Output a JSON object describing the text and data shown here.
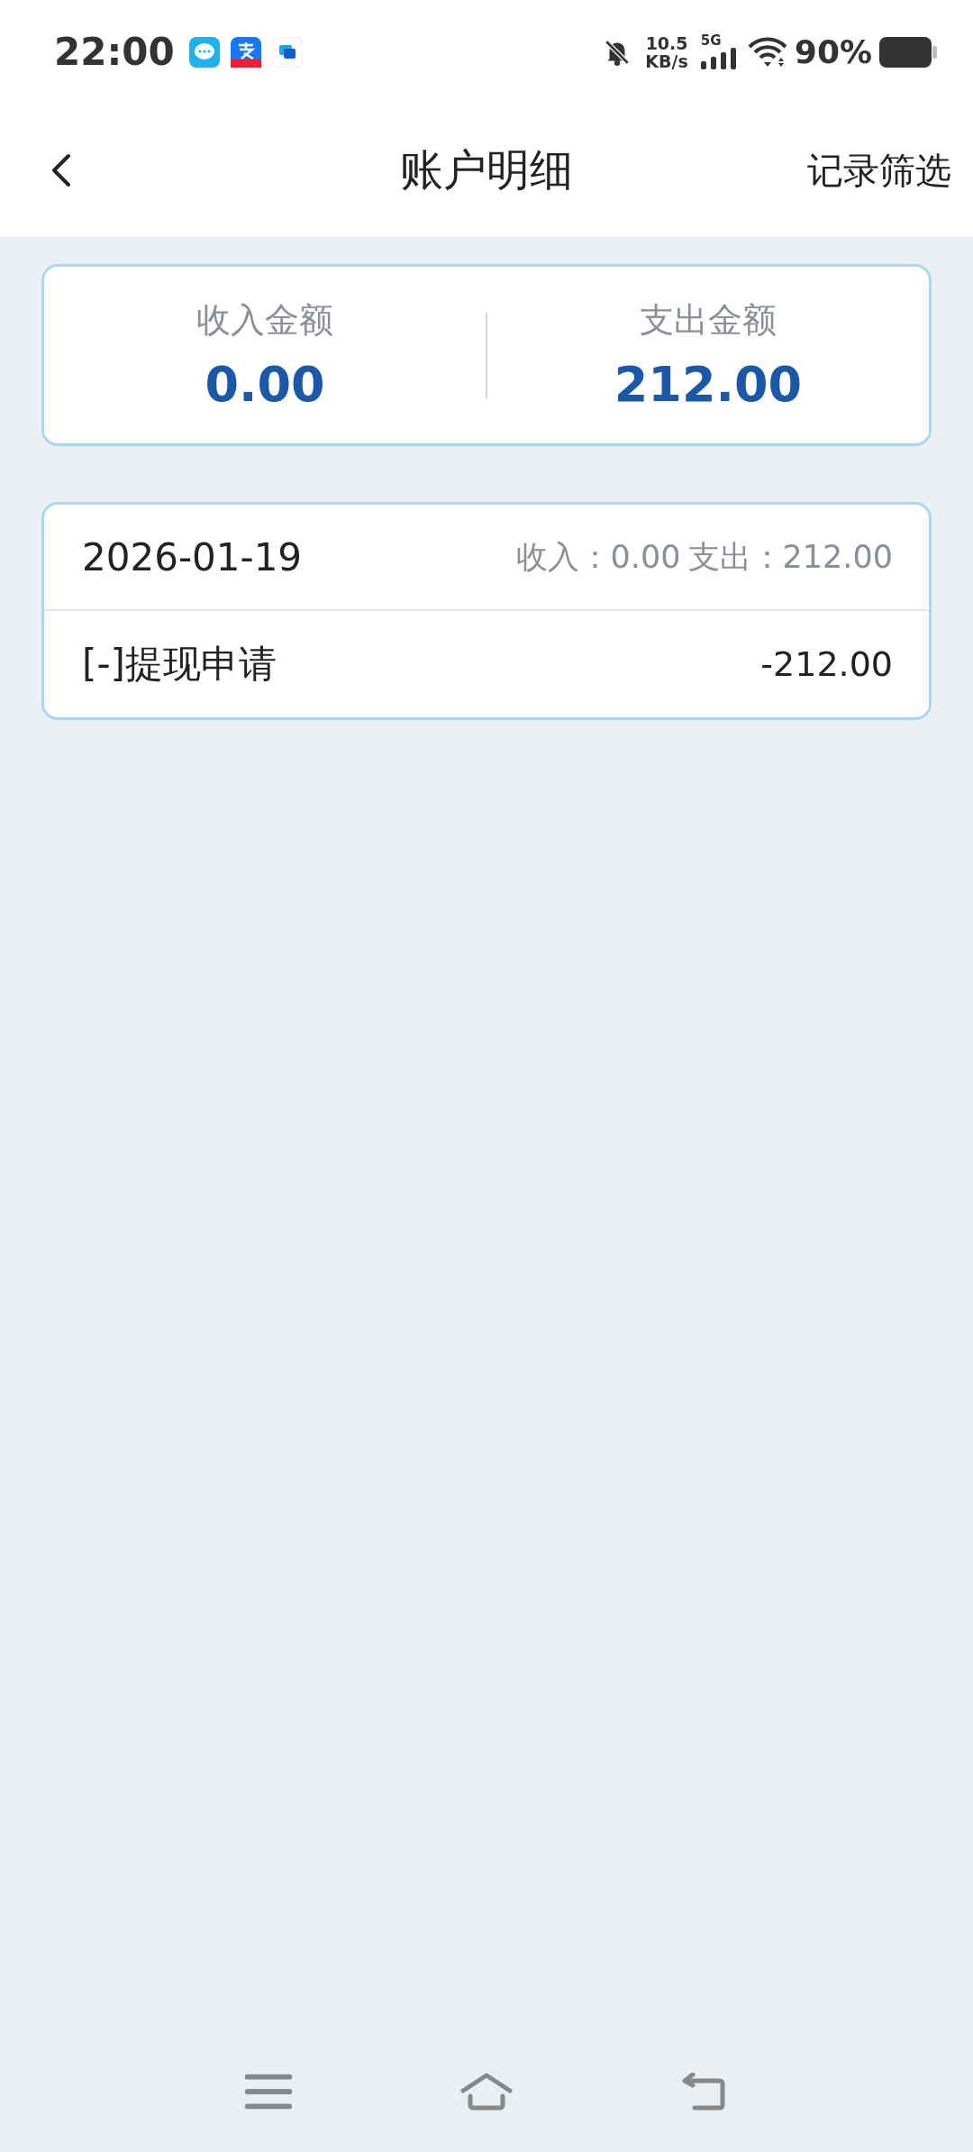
{
  "status_bar": {
    "time": "22:00",
    "speed_value": "10.5",
    "speed_unit": "KB/s",
    "network": "5G",
    "battery": "90%"
  },
  "header": {
    "title": "账户明细",
    "action": "记录筛选"
  },
  "summary": [
    {
      "label": "收入金额",
      "value": "0.00"
    },
    {
      "label": "支出金额",
      "value": "212.00"
    }
  ],
  "records": [
    {
      "date": "2026-01-19",
      "income": "收入：0.00",
      "expense": "支出：212.00",
      "items": [
        {
          "title": "[-]提现申请",
          "amount": "-212.00"
        }
      ]
    }
  ]
}
